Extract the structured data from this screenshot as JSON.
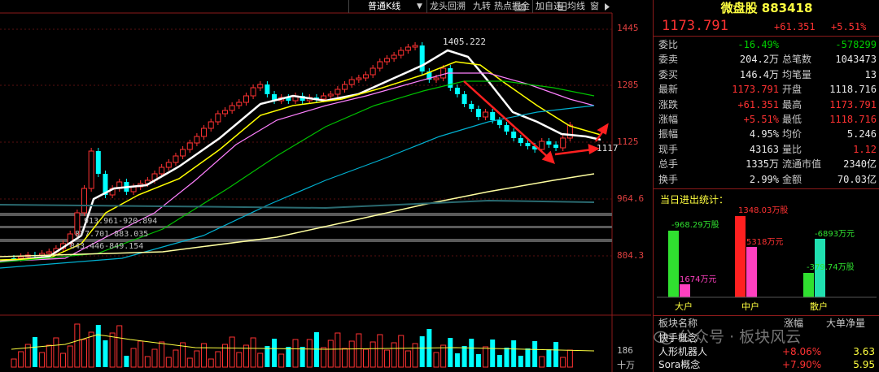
{
  "toolbar": {
    "items": [
      "普通K线",
      "▼",
      "龙头回溯",
      "九转",
      "热点掘金",
      "加自选",
      "均线",
      "窗"
    ],
    "icons": [
      "camera-icon",
      "grid-icon",
      "expand-icon",
      "collapse-icon",
      "menu-icon"
    ]
  },
  "axis": {
    "labels": [
      "1445",
      "1285",
      "1125",
      "964.6",
      "804.3",
      "186",
      "十万"
    ]
  },
  "annotations": {
    "peak": "1405.222",
    "current": "1117",
    "gaps": [
      "913.961-920.894",
      "877.701-883.035",
      "843.446-849.154"
    ]
  },
  "panel": {
    "title": "微盘股 883418",
    "price": "1173.791",
    "change": "+61.351",
    "pct": "+5.51%",
    "rows": [
      {
        "l1": "委比",
        "v1": "-16.49%",
        "c1": "green",
        "l2": "",
        "v2": "-578299",
        "c2": "green"
      },
      {
        "l1": "委卖",
        "v1": "204.2万",
        "c1": "white",
        "l2": "总笔数",
        "v2": "1043473",
        "c2": "white"
      },
      {
        "l1": "委买",
        "v1": "146.4万",
        "c1": "white",
        "l2": "均笔量",
        "v2": "13",
        "c2": "white"
      },
      {
        "l1": "最新",
        "v1": "1173.791",
        "c1": "red",
        "l2": "开盘",
        "v2": "1118.716",
        "c2": "white"
      },
      {
        "l1": "涨跌",
        "v1": "+61.351",
        "c1": "red",
        "l2": "最高",
        "v2": "1173.791",
        "c2": "red"
      },
      {
        "l1": "涨幅",
        "v1": "+5.51%",
        "c1": "red",
        "l2": "最低",
        "v2": "1118.716",
        "c2": "red"
      },
      {
        "l1": "振幅",
        "v1": "4.95%",
        "c1": "white",
        "l2": "均价",
        "v2": "5.246",
        "c2": "white"
      },
      {
        "l1": "现手",
        "v1": "43163",
        "c1": "white",
        "l2": "量比",
        "v2": "1.12",
        "c2": "red"
      },
      {
        "l1": "总手",
        "v1": "1335万",
        "c1": "white",
        "l2": "流通市值",
        "v2": "2340亿",
        "c2": "white"
      },
      {
        "l1": "换手",
        "v1": "2.99%",
        "c1": "white",
        "l2": "金额",
        "v2": "70.03亿",
        "c2": "white"
      }
    ],
    "stats_title": "当日进出统计：",
    "groups": [
      {
        "name": "大户",
        "net": "-968.29万股",
        "net_color": "green",
        "amt": "1674万元",
        "in_level": 0.82,
        "out_level": 0.16
      },
      {
        "name": "中户",
        "net": "1348.03万股",
        "net_color": "red",
        "amt": "5318万元",
        "in_level": 1.0,
        "out_level": 0.62
      },
      {
        "name": "散户",
        "net": "-379.74万股",
        "net_color": "green",
        "amt": "-6893万元",
        "in_level": 0.3,
        "out_level": 0.72
      }
    ],
    "sector_header": [
      "板块名称",
      "涨幅",
      "大单净量"
    ],
    "sectors": [
      {
        "name": "快手概念",
        "pct": "",
        "net": ""
      },
      {
        "name": "人形机器人",
        "pct": "+8.06%",
        "net": "3.63"
      },
      {
        "name": "Sora概念",
        "pct": "+7.90%",
        "net": "5.95"
      }
    ],
    "watermark": "公众号 · 板块风云"
  },
  "colors": {
    "up": "#ff3232",
    "down": "#00ffff",
    "ma5": "#ffffff",
    "ma10": "#ffff00",
    "ma20": "#ff80ff",
    "ma30": "#00c000",
    "ma60": "#00b0d0",
    "ma120": "#ffffa0"
  }
}
